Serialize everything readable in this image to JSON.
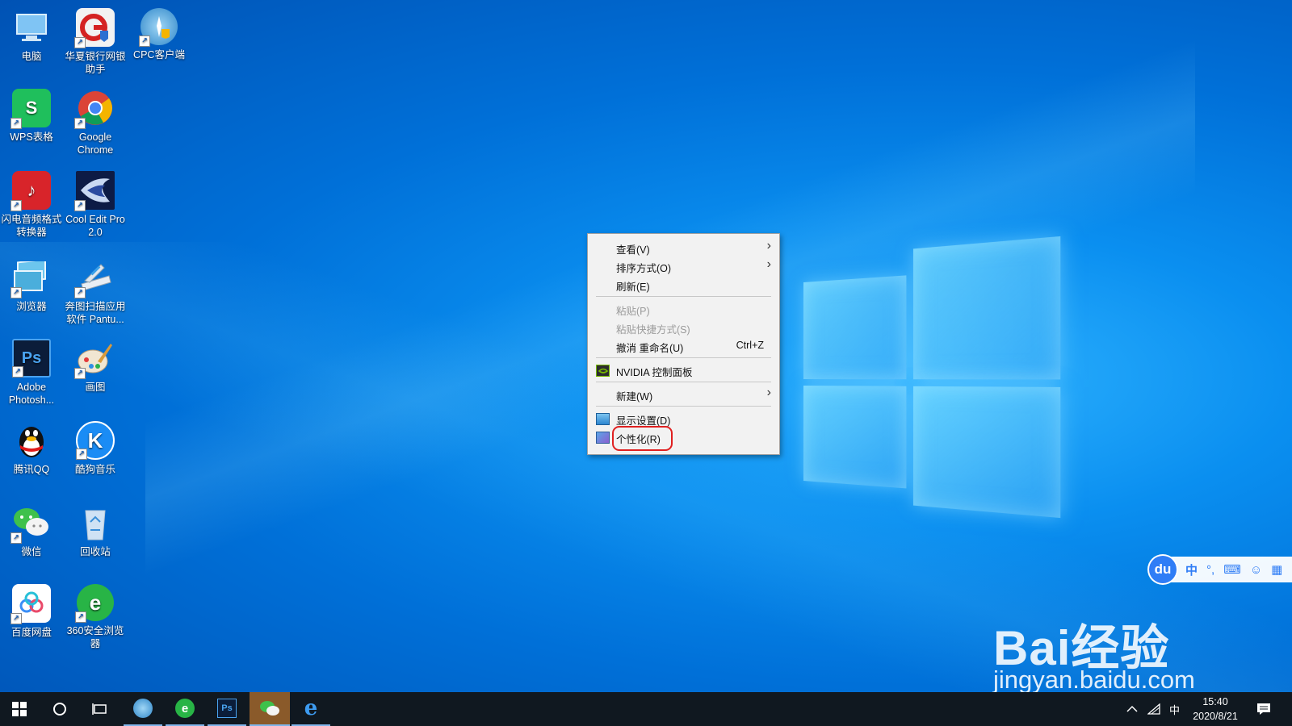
{
  "desktop": {
    "icons": [
      {
        "label": "电脑",
        "icon": "computer-icon"
      },
      {
        "label": "华夏银行网银助手",
        "icon": "bank-icon"
      },
      {
        "label": "CPC客户端",
        "icon": "cpc-icon"
      },
      {
        "label": "WPS表格",
        "icon": "wps-sheet-icon"
      },
      {
        "label": "Google Chrome",
        "icon": "chrome-icon"
      },
      {
        "label": "闪电音频格式转换器",
        "icon": "audio-converter-icon"
      },
      {
        "label": "Cool Edit Pro 2.0",
        "icon": "cool-edit-icon"
      },
      {
        "label": "浏览器",
        "icon": "browser-icon"
      },
      {
        "label": "奔图扫描应用软件 Pantu...",
        "icon": "scanner-icon"
      },
      {
        "label": "Adobe Photosh...",
        "icon": "photoshop-icon"
      },
      {
        "label": "画图",
        "icon": "paint-icon"
      },
      {
        "label": "腾讯QQ",
        "icon": "qq-icon"
      },
      {
        "label": "酷狗音乐",
        "icon": "kugou-icon"
      },
      {
        "label": "微信",
        "icon": "wechat-icon"
      },
      {
        "label": "回收站",
        "icon": "recycle-bin-icon"
      },
      {
        "label": "百度网盘",
        "icon": "baidu-netdisk-icon"
      },
      {
        "label": "360安全浏览器",
        "icon": "360-browser-icon"
      }
    ]
  },
  "context_menu": {
    "view": "查看(V)",
    "sort": "排序方式(O)",
    "refresh": "刷新(E)",
    "paste": "粘贴(P)",
    "paste_shortcut": "粘贴快捷方式(S)",
    "undo_rename": "撤消 重命名(U)",
    "undo_shortcut": "Ctrl+Z",
    "nvidia": "NVIDIA 控制面板",
    "new": "新建(W)",
    "display_settings": "显示设置(D)",
    "personalize": "个性化(R)"
  },
  "baidu_toolbar": {
    "logo": "du",
    "lang": "中"
  },
  "watermark": {
    "line1": "Bai经验",
    "line2": "jingyan.baidu.com"
  },
  "taskbar": {
    "ime": "中",
    "time": "15:40",
    "date": "2020/8/21"
  },
  "colors": {
    "desktop_blue": "#0a8ff0",
    "taskbar": "#101820",
    "highlight_ring": "#e02020"
  }
}
